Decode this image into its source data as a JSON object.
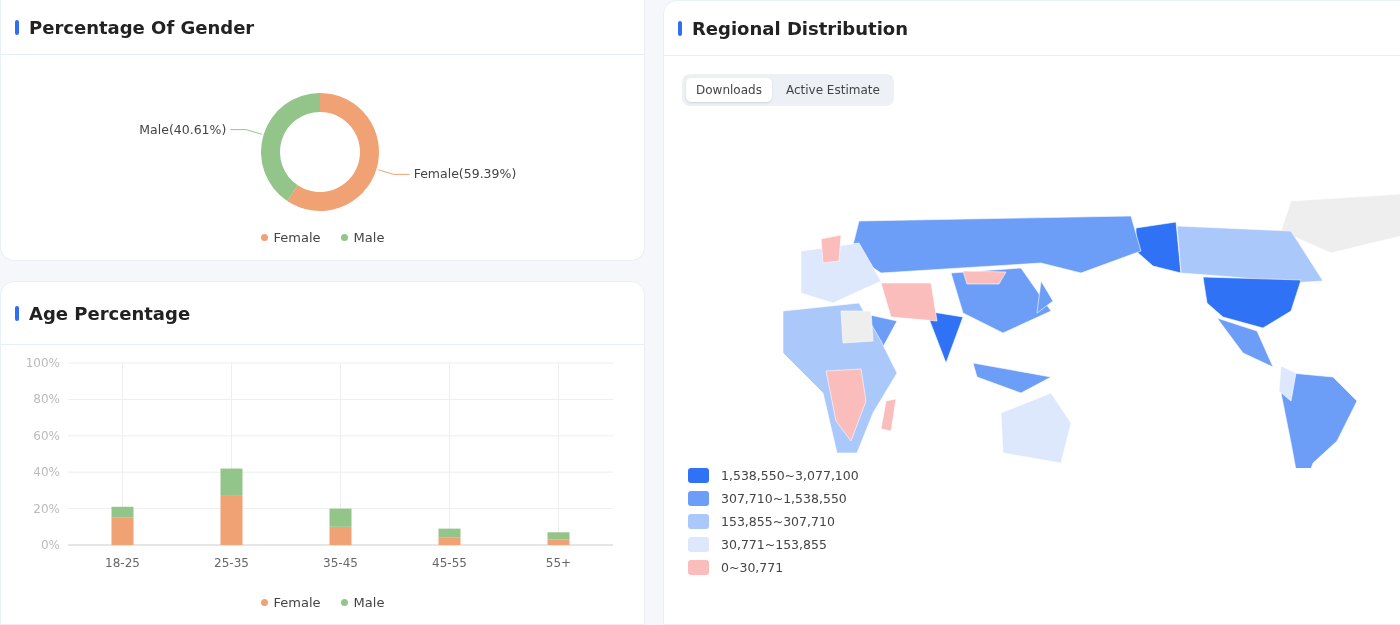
{
  "gender_panel": {
    "title": "Percentage Of Gender",
    "chart_data": {
      "type": "donut",
      "categories": [
        "Female",
        "Male"
      ],
      "values": [
        59.39,
        40.61
      ],
      "legend": true,
      "colors": [
        "#f0a274",
        "#93c58a"
      ],
      "value_labels": [
        "Female(59.39%)",
        "Male(40.61%)"
      ]
    }
  },
  "age_panel": {
    "title": "Age Percentage",
    "chart_data": {
      "type": "bar",
      "stacked": true,
      "categories": [
        "18-25",
        "25-35",
        "35-45",
        "45-55",
        "55+"
      ],
      "series": [
        {
          "name": "Female",
          "color": "#f0a274",
          "values": [
            15,
            27,
            10,
            4,
            3
          ]
        },
        {
          "name": "Male",
          "color": "#93c58a",
          "values": [
            6,
            15,
            10,
            5,
            4
          ]
        }
      ],
      "ylim": [
        0,
        100
      ],
      "grid": true,
      "legend": true,
      "yticks": [
        {
          "value": 0,
          "label": "0%"
        },
        {
          "value": 20,
          "label": "20%"
        },
        {
          "value": 40,
          "label": "40%"
        },
        {
          "value": 60,
          "label": "60%"
        },
        {
          "value": 80,
          "label": "80%"
        },
        {
          "value": 100,
          "label": "100%"
        }
      ]
    }
  },
  "region_panel": {
    "title": "Regional Distribution",
    "tabs": [
      {
        "label": "Downloads",
        "selected": true
      },
      {
        "label": "Active Estimate",
        "selected": false
      }
    ],
    "legend": [
      {
        "label": "1,538,550~3,077,100",
        "color": "#2f72f5"
      },
      {
        "label": "307,710~1,538,550",
        "color": "#6c9ef8"
      },
      {
        "label": "153,855~307,710",
        "color": "#abc8fb"
      },
      {
        "label": "30,771~153,855",
        "color": "#dde8fd"
      },
      {
        "label": "0~30,771",
        "color": "#fbbcbc"
      }
    ]
  }
}
